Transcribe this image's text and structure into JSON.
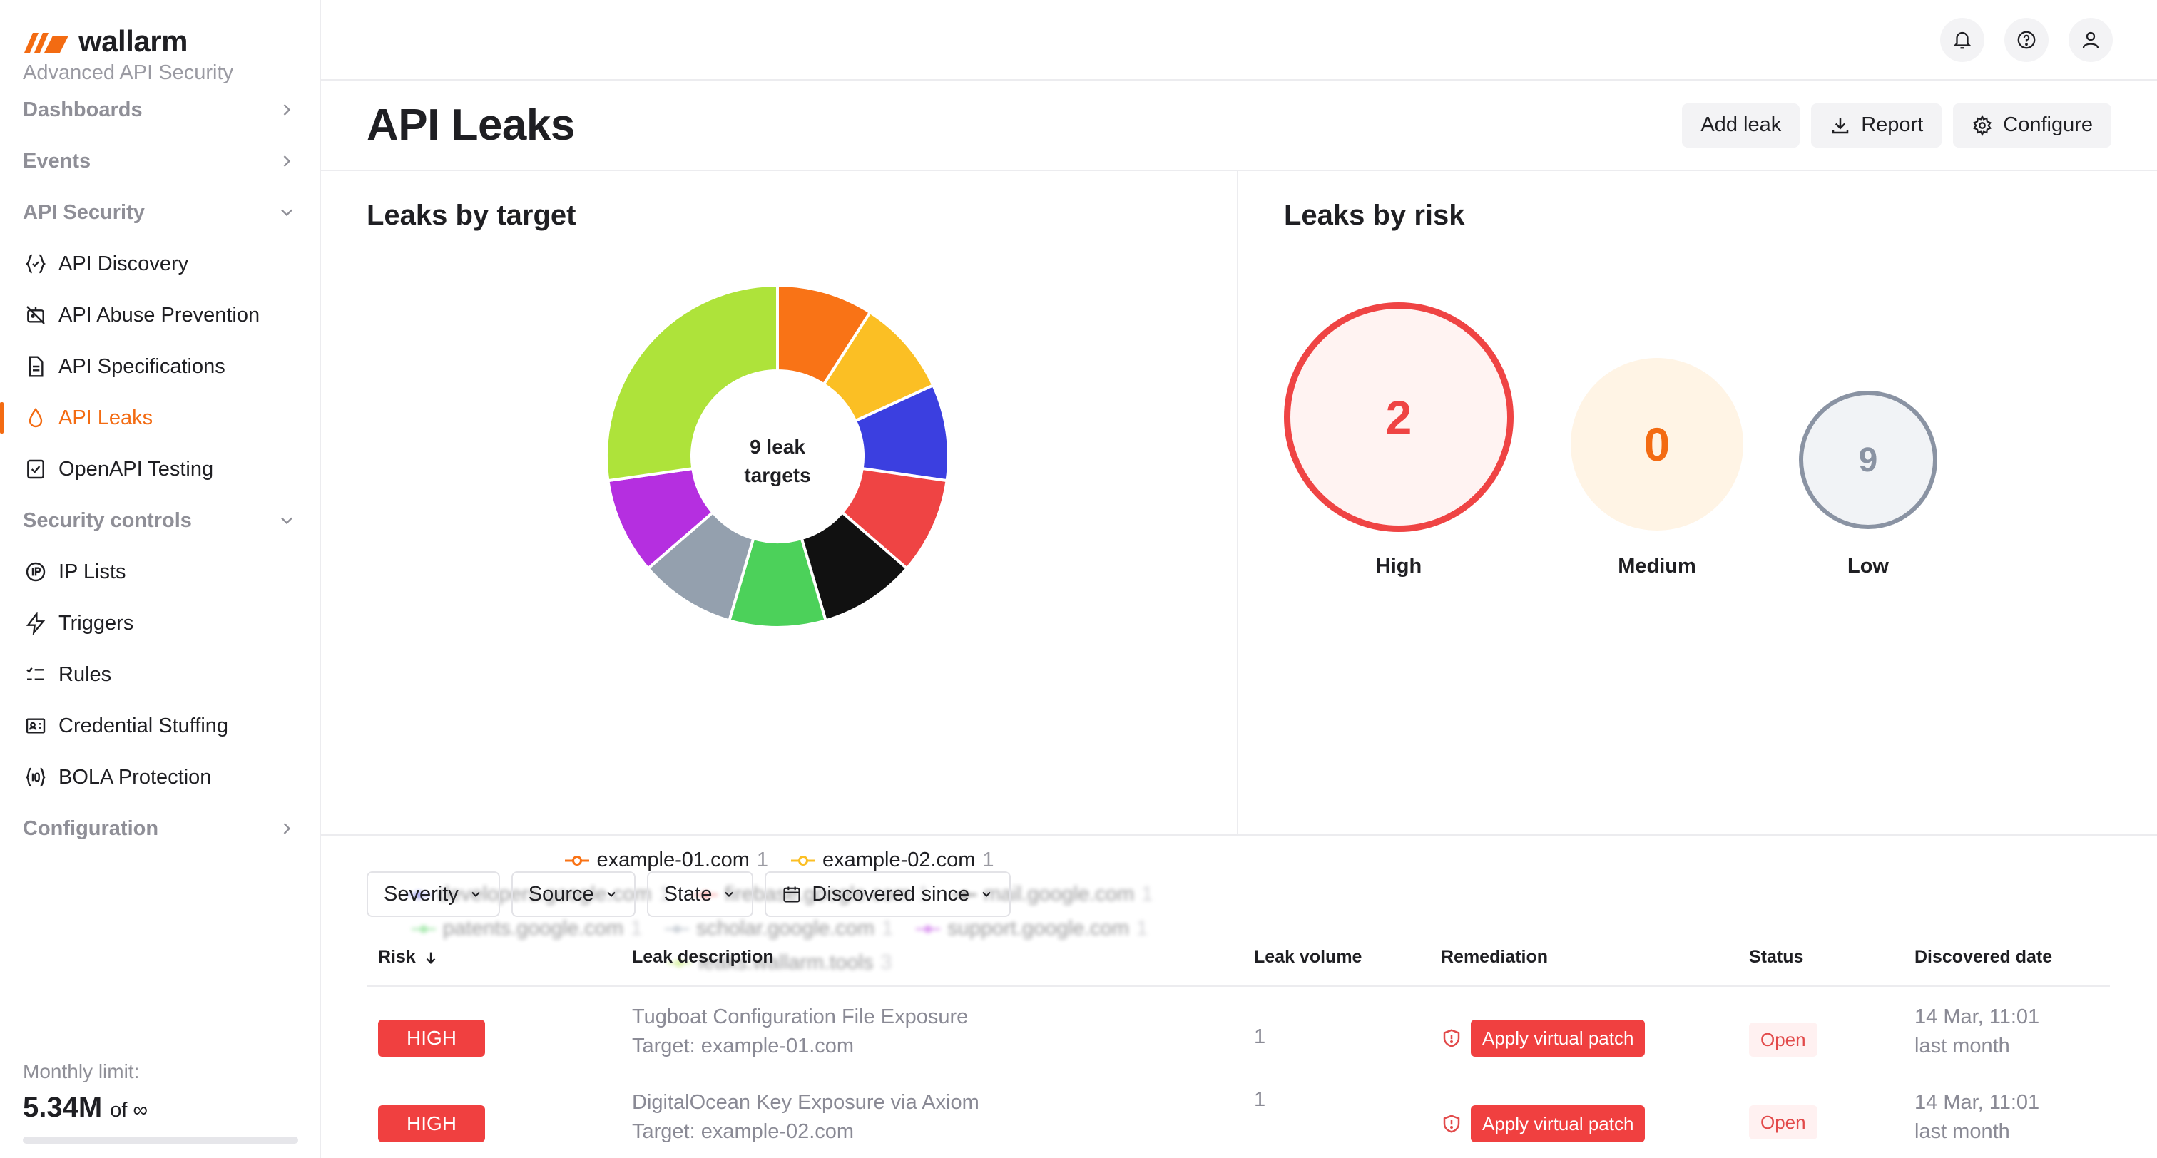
{
  "brand": {
    "name": "wallarm",
    "subtitle": "Advanced API Security",
    "accent": "#f36b12"
  },
  "sidebar": {
    "groups": {
      "dashboards": "Dashboards",
      "events": "Events",
      "api_security": "API Security",
      "security_controls": "Security controls",
      "configuration": "Configuration"
    },
    "api_security_items": [
      {
        "label": "API Discovery",
        "icon": "code-braces-icon"
      },
      {
        "label": "API Abuse Prevention",
        "icon": "bot-off-icon"
      },
      {
        "label": "API Specifications",
        "icon": "document-icon"
      },
      {
        "label": "API Leaks",
        "icon": "droplet-icon",
        "active": true
      },
      {
        "label": "OpenAPI Testing",
        "icon": "checklist-icon"
      }
    ],
    "security_controls_items": [
      {
        "label": "IP Lists",
        "icon": "ip-icon"
      },
      {
        "label": "Triggers",
        "icon": "bolt-icon"
      },
      {
        "label": "Rules",
        "icon": "rules-icon"
      },
      {
        "label": "Credential Stuffing",
        "icon": "id-card-icon"
      },
      {
        "label": "BOLA Protection",
        "icon": "id-braces-icon"
      }
    ],
    "limit": {
      "label": "Monthly limit:",
      "value": "5.34M",
      "of": "of ∞"
    }
  },
  "topbar": {
    "icons": [
      "bell-icon",
      "help-icon",
      "user-icon"
    ]
  },
  "page": {
    "title": "API Leaks",
    "actions": {
      "add": "Add leak",
      "report": "Report",
      "configure": "Configure"
    }
  },
  "leaks_by_target": {
    "title": "Leaks by target",
    "center_line1": "9 leak",
    "center_line2": "targets",
    "legend_visible": [
      {
        "label": "example-01.com",
        "count": "1",
        "color": "#f97316"
      },
      {
        "label": "example-02.com",
        "count": "1",
        "color": "#fbbf24"
      }
    ],
    "legend_blurred": [
      {
        "label": "developers.google.com",
        "count": "1",
        "color": "#3b3fe0"
      },
      {
        "label": "firebase.google.com",
        "count": "1",
        "color": "#ef4444"
      },
      {
        "label": "mail.google.com",
        "count": "1",
        "color": "#111111"
      },
      {
        "label": "patents.google.com",
        "count": "1",
        "color": "#4cd15a"
      },
      {
        "label": "scholar.google.com",
        "count": "1",
        "color": "#94a0ae"
      },
      {
        "label": "support.google.com",
        "count": "1",
        "color": "#b52fe0"
      },
      {
        "label": "leaks.wallarm.tools",
        "count": "3",
        "color": "#aee33a"
      }
    ]
  },
  "chart_data": {
    "type": "pie",
    "title": "Leaks by target",
    "categories": [
      "example-01.com",
      "example-02.com",
      "developers.google.com",
      "firebase.google.com",
      "mail.google.com",
      "patents.google.com",
      "scholar.google.com",
      "support.google.com",
      "leaks.wallarm.tools"
    ],
    "values": [
      1,
      1,
      1,
      1,
      1,
      1,
      1,
      1,
      3
    ],
    "colors": [
      "#f97316",
      "#fbbf24",
      "#3b3fe0",
      "#ef4444",
      "#111111",
      "#4cd15a",
      "#94a0ae",
      "#b52fe0",
      "#aee33a"
    ]
  },
  "leaks_by_risk": {
    "title": "Leaks by risk",
    "items": [
      {
        "label": "High",
        "value": "2",
        "color": "#ef4444"
      },
      {
        "label": "Medium",
        "value": "0",
        "color": "#f36b12"
      },
      {
        "label": "Low",
        "value": "9",
        "color": "#8a93a3"
      }
    ]
  },
  "filters": {
    "severity": "Severity",
    "source": "Source",
    "state": "State",
    "discovered": "Discovered since"
  },
  "table": {
    "headers": {
      "risk": "Risk",
      "description": "Leak description",
      "volume": "Leak volume",
      "remediation": "Remediation",
      "status": "Status",
      "date": "Discovered date"
    },
    "rows": [
      {
        "risk": "HIGH",
        "title": "Tugboat Configuration File Exposure",
        "target": "Target: example-01.com",
        "volume": "1",
        "remediation": "Apply virtual patch",
        "status": "Open",
        "date": "14 Mar, 11:01",
        "relative": "last month"
      },
      {
        "risk": "HIGH",
        "title": "DigitalOcean Key Exposure via Axiom",
        "target": "Target: example-02.com",
        "volume": "1",
        "remediation": "Apply virtual patch",
        "status": "Open",
        "date": "14 Mar, 11:01",
        "relative": "last month"
      }
    ]
  }
}
